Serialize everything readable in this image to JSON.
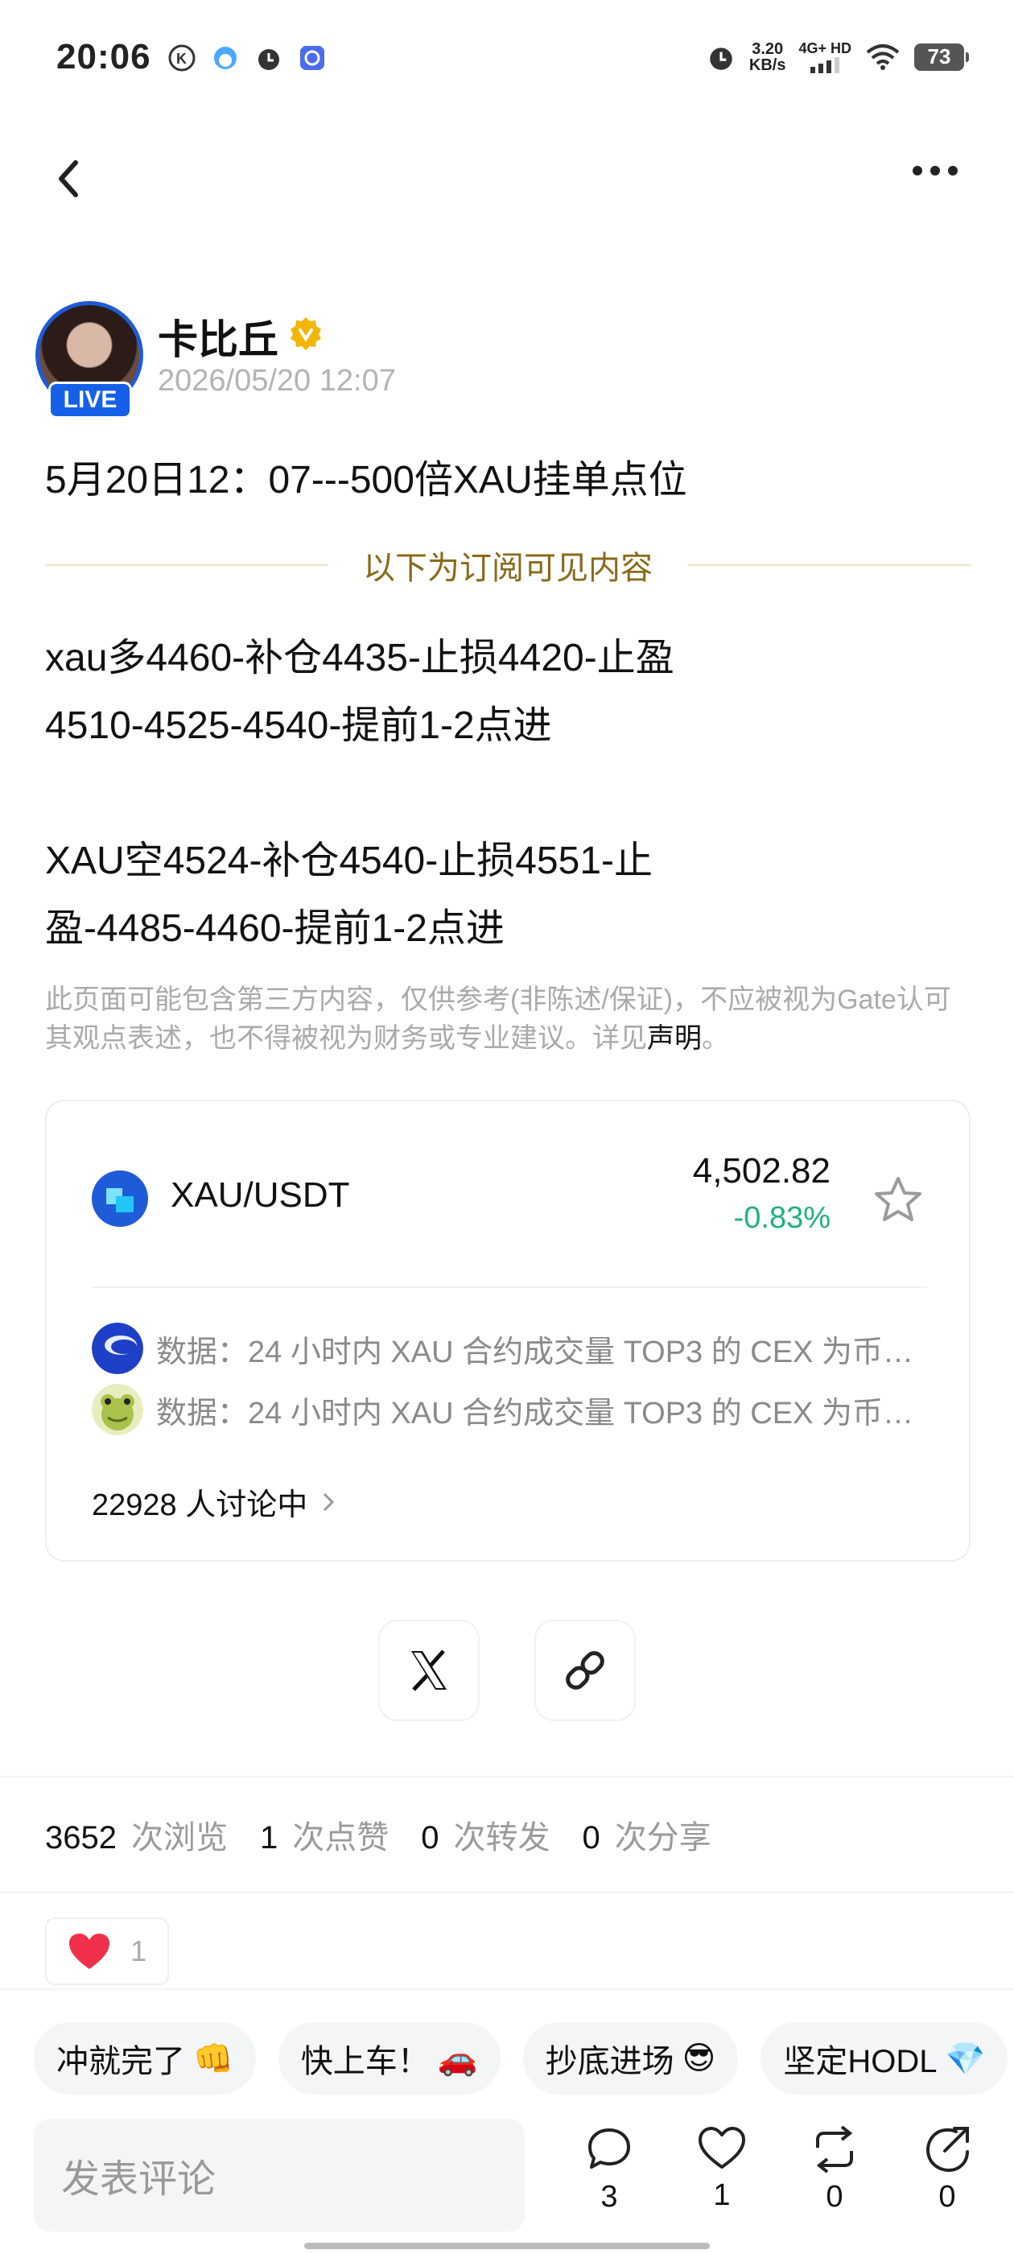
{
  "status_bar": {
    "time": "20:06",
    "net_speed_value": "3.20",
    "net_speed_unit": "KB/s",
    "network": "4G+ HD",
    "battery": "73"
  },
  "author": {
    "name": "卡比丘",
    "live_badge": "LIVE",
    "timestamp": "2026/05/20 12:07"
  },
  "post": {
    "title": "5月20日12：07---500倍XAU挂单点位",
    "subscriber_divider": "以下为订阅可见内容",
    "body_lines": [
      "xau多4460-补仓4435-止损4420-止盈",
      "4510-4525-4540-提前1-2点进",
      "",
      "XAU空4524-补仓4540-止损4551-止",
      "盈-4485-4460-提前1-2点进"
    ],
    "disclaimer": "此页面可能包含第三方内容，仅供参考(非陈述/保证)，不应被视为Gate认可其观点表述，也不得被视为财务或专业建议。详见",
    "disclaimer_link": "声明",
    "disclaimer_end": "。"
  },
  "market_card": {
    "pair": "XAU/USDT",
    "price": "4,502.82",
    "change": "-0.83%",
    "news": [
      "数据：24 小时内 XAU 合约成交量 TOP3 的 CEX 为币…",
      "数据：24 小时内 XAU 合约成交量 TOP3 的 CEX 为币…"
    ],
    "discussing": "22928 人讨论中"
  },
  "stats": {
    "views": "3652",
    "views_label": "次浏览",
    "likes": "1",
    "likes_label": "次点赞",
    "reposts": "0",
    "reposts_label": "次转发",
    "shares": "0",
    "shares_label": "次分享"
  },
  "reaction": {
    "count": "1"
  },
  "quick_replies": [
    {
      "text": "冲就完了",
      "emoji": "👊"
    },
    {
      "text": "快上车！",
      "emoji": "🚗"
    },
    {
      "text": "抄底进场",
      "emoji": "😎"
    },
    {
      "text": "坚定HODL",
      "emoji": "💎"
    }
  ],
  "bottom_bar": {
    "comment_placeholder": "发表评论",
    "comments": "3",
    "likes": "1",
    "reposts": "0",
    "shares": "0"
  },
  "colors": {
    "accent_blue": "#1e5bd8",
    "positive_green": "#1fb27a",
    "gold_text": "#8a6a1a",
    "verified_gold": "#f2b705",
    "heart_red": "#f0304a"
  }
}
